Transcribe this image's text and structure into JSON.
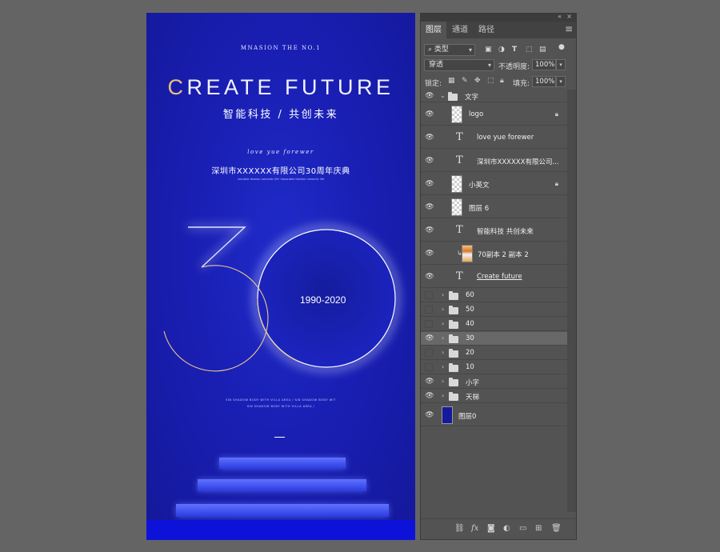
{
  "poster": {
    "brand": "MNASION THE NO.1",
    "headline_first": "C",
    "headline_rest": "REATE FUTURE",
    "subtitle_cn": "智能科技 / 共创未来",
    "script_line": "love yue forewer",
    "company": "深圳市XXXXXX有限公司30周年庆典",
    "tiny_english": "unicable fashion romantic life' honorable fashion romantic life",
    "years": "1990-2020",
    "small_lines": [
      "SIN SHADOW BODY WITH VILLA AREA  /  SIN SHADOW BODY WIT",
      "SIN SHADOW BODY WITH VILLA AREA  /"
    ],
    "colors": {
      "background": "#1a1fb4",
      "accent_gold": "#e8c27a",
      "step": "#4a5cff"
    }
  },
  "panel": {
    "tabs": [
      "图层",
      "通道",
      "路径"
    ],
    "active_tab": "图层",
    "filter": {
      "label": "类型",
      "icons": [
        "image-filter-icon",
        "adjustment-filter-icon",
        "type-filter-icon",
        "shape-filter-icon",
        "smart-object-filter-icon",
        "toggle-filter-icon"
      ]
    },
    "blend_mode": "穿透",
    "opacity_label": "不透明度:",
    "opacity_value": "100%",
    "lock_label": "锁定:",
    "fill_label": "填充:",
    "fill_value": "100%",
    "layers": [
      {
        "name": "文字",
        "kind": "group",
        "visible": true,
        "expanded": true,
        "indent": 0
      },
      {
        "name": "logo",
        "kind": "pixel",
        "visible": true,
        "locked": true,
        "indent": 1
      },
      {
        "name": "love yue forewer",
        "kind": "text",
        "visible": true,
        "indent": 1
      },
      {
        "name": "深圳市XXXXXX有限公司...",
        "kind": "text",
        "visible": true,
        "indent": 1
      },
      {
        "name": "小英文",
        "kind": "pixel",
        "visible": true,
        "locked": true,
        "indent": 1
      },
      {
        "name": "图层 6",
        "kind": "pixel",
        "visible": true,
        "indent": 1
      },
      {
        "name": "智能科技  共创未来",
        "kind": "text",
        "visible": true,
        "indent": 1
      },
      {
        "name": "70副本 2 副本 2",
        "kind": "image",
        "visible": true,
        "clipped": true,
        "indent": 1
      },
      {
        "name": "Create future",
        "kind": "text",
        "visible": true,
        "underline": true,
        "indent": 1
      },
      {
        "name": "60",
        "kind": "group",
        "visible": false,
        "indent": 0
      },
      {
        "name": "50",
        "kind": "group",
        "visible": false,
        "indent": 0
      },
      {
        "name": "40",
        "kind": "group",
        "visible": false,
        "indent": 0
      },
      {
        "name": "30",
        "kind": "group",
        "visible": true,
        "selected": true,
        "indent": 0
      },
      {
        "name": "20",
        "kind": "group",
        "visible": false,
        "indent": 0
      },
      {
        "name": "10",
        "kind": "group",
        "visible": false,
        "indent": 0
      },
      {
        "name": "小字",
        "kind": "group",
        "visible": true,
        "indent": 0
      },
      {
        "name": "天梯",
        "kind": "group",
        "visible": true,
        "indent": 0
      },
      {
        "name": "图层0",
        "kind": "fill",
        "visible": true,
        "indent": 0
      }
    ],
    "bottom_icons": [
      "link-layers-icon",
      "fx-icon",
      "add-mask-icon",
      "adjustment-layer-icon",
      "new-group-icon",
      "new-layer-icon",
      "delete-layer-icon"
    ],
    "bottom_fx_label": "fx"
  }
}
